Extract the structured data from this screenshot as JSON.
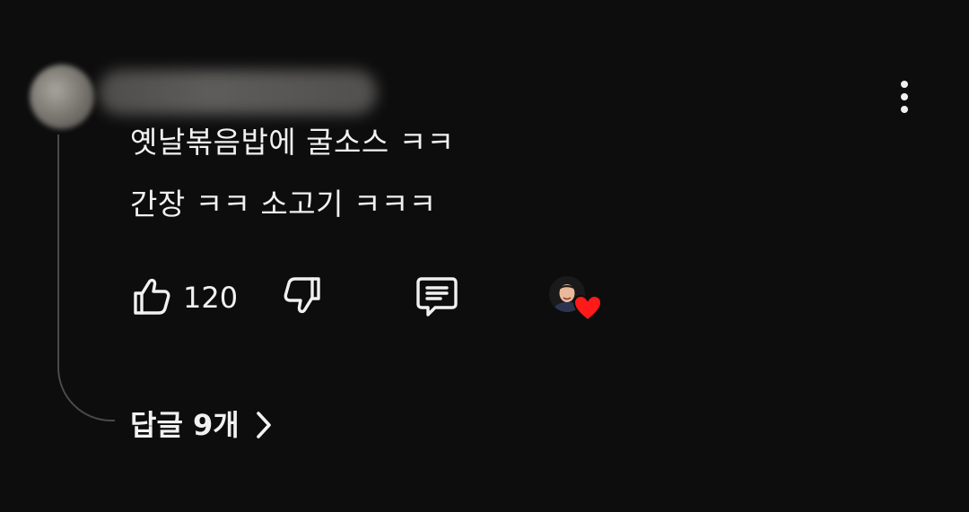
{
  "comment": {
    "author_name": "",
    "lines": [
      "옛날볶음밥에 굴소스 ㅋㅋ",
      "간장 ㅋㅋ 소고기 ㅋㅋㅋ"
    ]
  },
  "actions": {
    "like_icon": "thumbs-up-icon",
    "like_count": "120",
    "dislike_icon": "thumbs-down-icon",
    "reply_icon": "comment-icon",
    "creator_heart_icon": "heart-icon",
    "more_icon": "more-vertical-icon"
  },
  "replies": {
    "label": "답글 9개",
    "chevron_icon": "chevron-right-icon"
  },
  "colors": {
    "background": "#0d0d0e",
    "text": "#f1f1f1",
    "thread_line": "#4a4a4a",
    "heart": "#ff1a1a"
  }
}
